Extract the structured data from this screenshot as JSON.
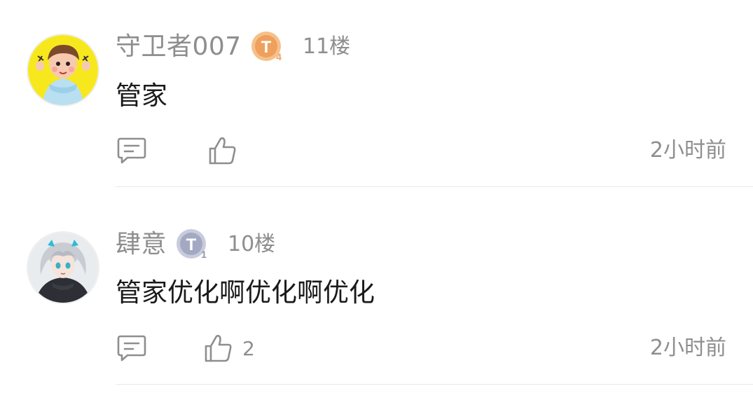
{
  "comments": [
    {
      "username": "守卫者007",
      "level_badge_letter": "T",
      "level_badge_number": "4",
      "level_badge_color": "#f0a860",
      "floor": "11楼",
      "content": "管家",
      "like_count": "",
      "time": "2小时前",
      "avatar_icon": "cartoon-boy-avatar"
    },
    {
      "username": "肆意",
      "level_badge_letter": "T",
      "level_badge_number": "1",
      "level_badge_color": "#a8aec8",
      "floor": "10楼",
      "content": "管家优化啊优化啊优化",
      "like_count": "2",
      "time": "2小时前",
      "avatar_icon": "anime-girl-avatar"
    }
  ],
  "icons": {
    "reply": "comment-bubble-icon",
    "like": "thumbs-up-icon"
  },
  "colors": {
    "secondary_text": "#8e8e8e",
    "primary_text": "#1a1a1a",
    "divider": "#e8e8e8"
  }
}
